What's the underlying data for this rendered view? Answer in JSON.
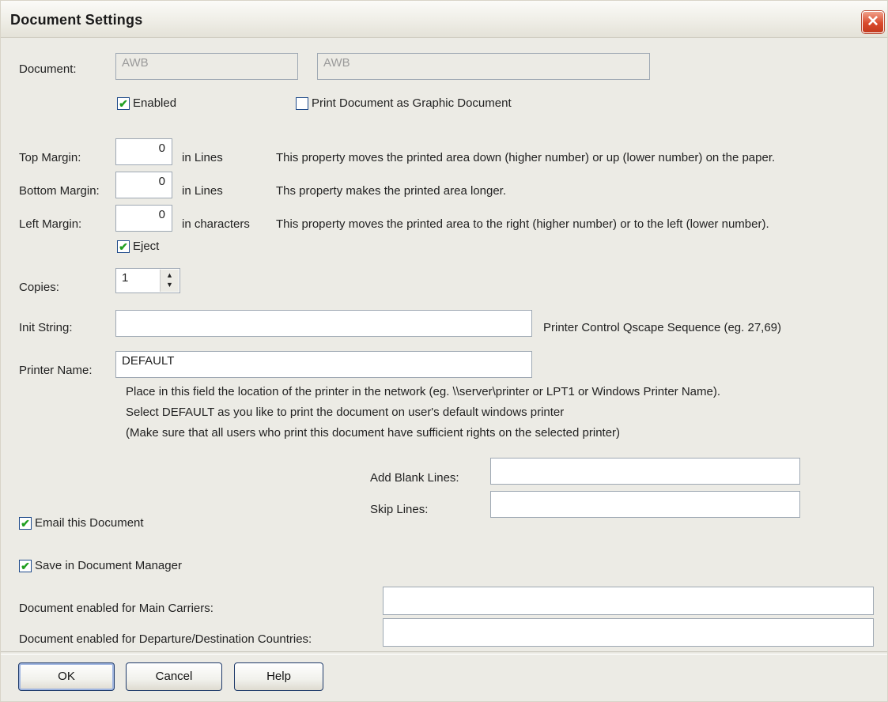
{
  "window": {
    "title": "Document Settings",
    "close_glyph": "✕"
  },
  "document": {
    "label": "Document:",
    "code": "AWB",
    "name": "AWB"
  },
  "enabled": {
    "label": "Enabled",
    "checked": true
  },
  "print_graphic": {
    "label": "Print Document as Graphic Document",
    "checked": false
  },
  "top_margin": {
    "label": "Top Margin:",
    "value": "0",
    "unit": "in Lines",
    "help": "This property moves the printed area down (higher number) or up (lower number) on the paper."
  },
  "bottom_margin": {
    "label": "Bottom Margin:",
    "value": "0",
    "unit": "in Lines",
    "help": "Ths property makes the printed area longer."
  },
  "left_margin": {
    "label": "Left Margin:",
    "value": "0",
    "unit": "in characters",
    "help": "This property moves the printed area to the right (higher number) or to the left (lower number)."
  },
  "eject": {
    "label": "Eject",
    "checked": true
  },
  "copies": {
    "label": "Copies:",
    "value": "1"
  },
  "init_string": {
    "label": "Init String:",
    "value": "",
    "help": "Printer Control Qscape Sequence (eg. 27,69)"
  },
  "printer_name": {
    "label": "Printer Name:",
    "value": "DEFAULT",
    "help_lines": [
      "Place in this field the location of the printer in the network (eg. \\\\server\\printer or LPT1 or Windows Printer Name).",
      "Select DEFAULT as you like to print the document on user's default windows printer",
      "(Make sure that all users who print this document have sufficient rights on the selected printer)"
    ]
  },
  "add_blank_lines": {
    "label": "Add Blank Lines:",
    "value": ""
  },
  "skip_lines": {
    "label": "Skip Lines:",
    "value": ""
  },
  "email": {
    "label": "Email this Document",
    "checked": true
  },
  "save_dm": {
    "label": "Save in Document Manager",
    "checked": true
  },
  "main_carriers": {
    "label": "Document enabled  for Main Carriers:",
    "value": ""
  },
  "countries": {
    "label": "Document enabled for Departure/Destination Countries:",
    "value": ""
  },
  "buttons": {
    "ok": "OK",
    "cancel": "Cancel",
    "help": "Help"
  },
  "icons": {
    "check": "✔",
    "spin_up": "▲",
    "spin_down": "▼"
  }
}
